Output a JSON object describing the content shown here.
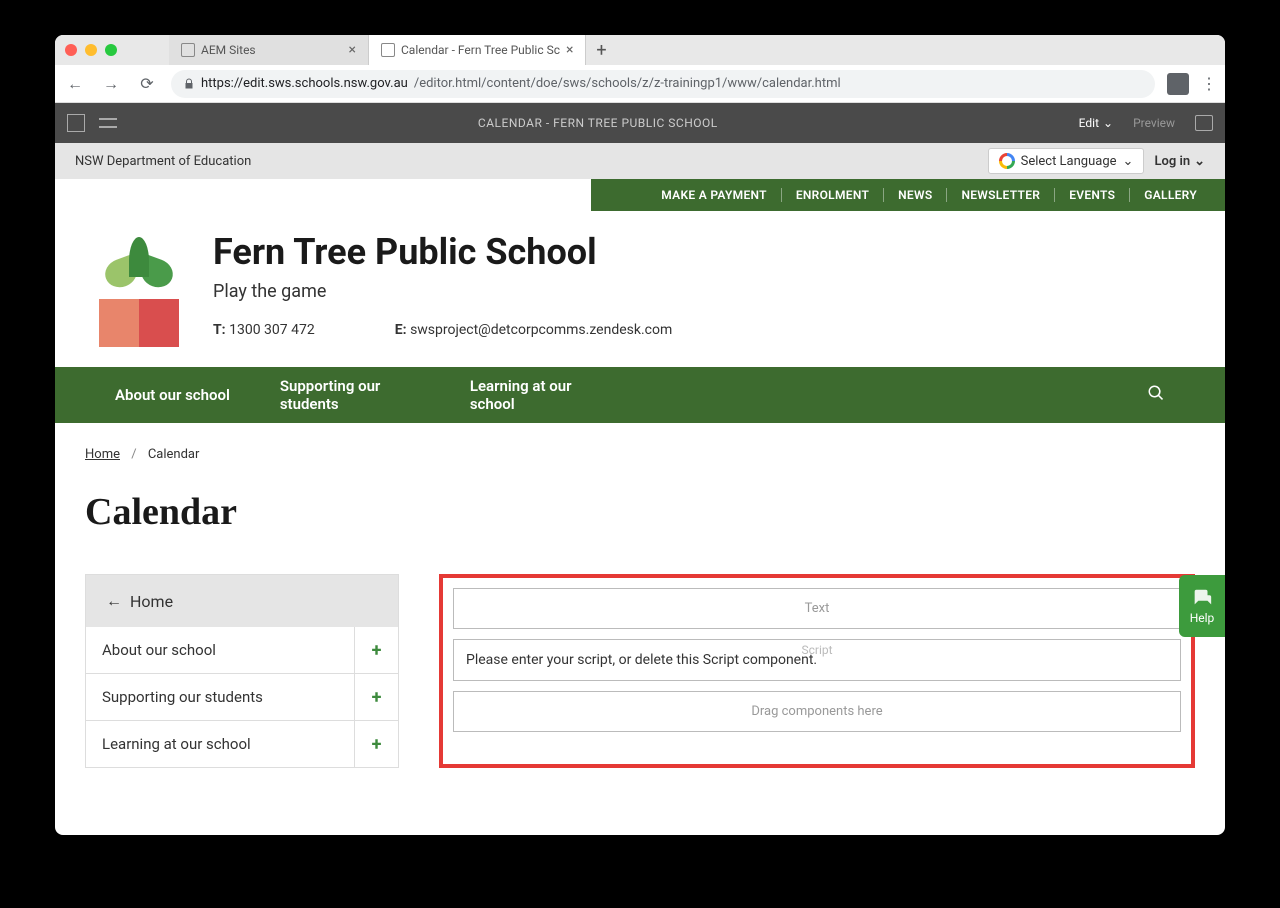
{
  "browser": {
    "tabs": [
      {
        "title": "AEM Sites",
        "active": false
      },
      {
        "title": "Calendar - Fern Tree Public Sc",
        "active": true
      }
    ],
    "url_host": "https://edit.sws.schools.nsw.gov.au",
    "url_path": "/editor.html/content/doe/sws/schools/z/z-trainingp1/www/calendar.html"
  },
  "aem": {
    "title": "CALENDAR - FERN TREE PUBLIC SCHOOL",
    "edit": "Edit",
    "preview": "Preview"
  },
  "subbar": {
    "dept": "NSW Department of Education",
    "lang": "Select Language",
    "login": "Log in"
  },
  "green_links": [
    "MAKE A PAYMENT",
    "ENROLMENT",
    "NEWS",
    "NEWSLETTER",
    "EVENTS",
    "GALLERY"
  ],
  "school": {
    "name": "Fern Tree Public School",
    "tagline": "Play the game",
    "phone_label": "T:",
    "phone": "1300 307 472",
    "email_label": "E:",
    "email": "swsproject@detcorpcomms.zendesk.com"
  },
  "nav": [
    "About our school",
    "Supporting our students",
    "Learning at our school"
  ],
  "breadcrumb": {
    "home": "Home",
    "current": "Calendar"
  },
  "page_title": "Calendar",
  "sidebar": {
    "home": "Home",
    "items": [
      "About our school",
      "Supporting our students",
      "Learning at our school"
    ]
  },
  "components": {
    "text": "Text",
    "script_label": "Script",
    "script_msg": "Please enter your script, or delete this Script component.",
    "drop": "Drag components here"
  },
  "help": "Help"
}
